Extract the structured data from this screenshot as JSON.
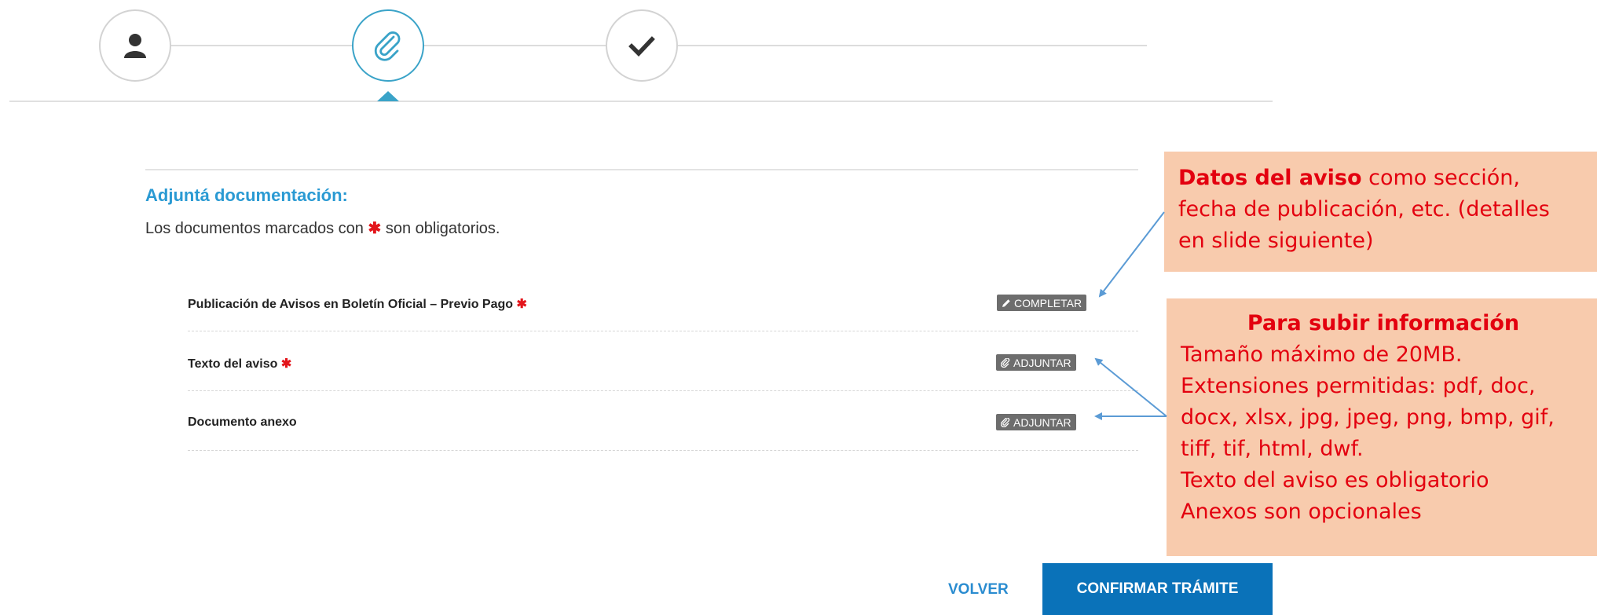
{
  "stepper": {
    "steps": [
      {
        "icon": "user-icon",
        "state": "done"
      },
      {
        "icon": "paperclip-icon",
        "state": "active"
      },
      {
        "icon": "check-icon",
        "state": "pending"
      }
    ],
    "active_color": "#3aa3c8"
  },
  "section": {
    "title": "Adjuntá documentación:",
    "required_note_before": "Los documentos marcados con",
    "required_mark": "✱",
    "required_note_after": "son obligatorios."
  },
  "documents": [
    {
      "label": "Publicación de Avisos en Boletín Oficial – Previo Pago",
      "required": true,
      "action_label": "COMPLETAR",
      "action_icon": "pencil-icon"
    },
    {
      "label": "Texto del aviso",
      "required": true,
      "action_label": "ADJUNTAR",
      "action_icon": "paperclip-icon"
    },
    {
      "label": "Documento anexo",
      "required": false,
      "action_label": "ADJUNTAR",
      "action_icon": "paperclip-icon"
    }
  ],
  "footer": {
    "back_label": "VOLVER",
    "confirm_label": "CONFIRMAR TRÁMITE"
  },
  "annotations": {
    "note1": {
      "bold": "Datos del aviso",
      "text_1": " como sección,",
      "text_2": "fecha de publicación, etc. (detalles",
      "text_3": "en slide siguiente)"
    },
    "note2": {
      "heading": "Para subir información",
      "lines": [
        "Tamaño máximo de 20MB.",
        "Extensiones permitidas: pdf, doc,",
        "docx, xlsx, jpg, jpeg, png, bmp, gif,",
        "tiff, tif, html, dwf.",
        "Texto del aviso es obligatorio",
        "Anexos son opcionales"
      ]
    },
    "note_bg": "#f8cbad",
    "note_text_color": "#e3000f",
    "arrow_color": "#5b9bd5"
  },
  "colors": {
    "title_blue": "#2a9ad3",
    "button_blue": "#0a72b9",
    "required_red": "#e3151b",
    "tag_gray": "#6d6d6d"
  }
}
